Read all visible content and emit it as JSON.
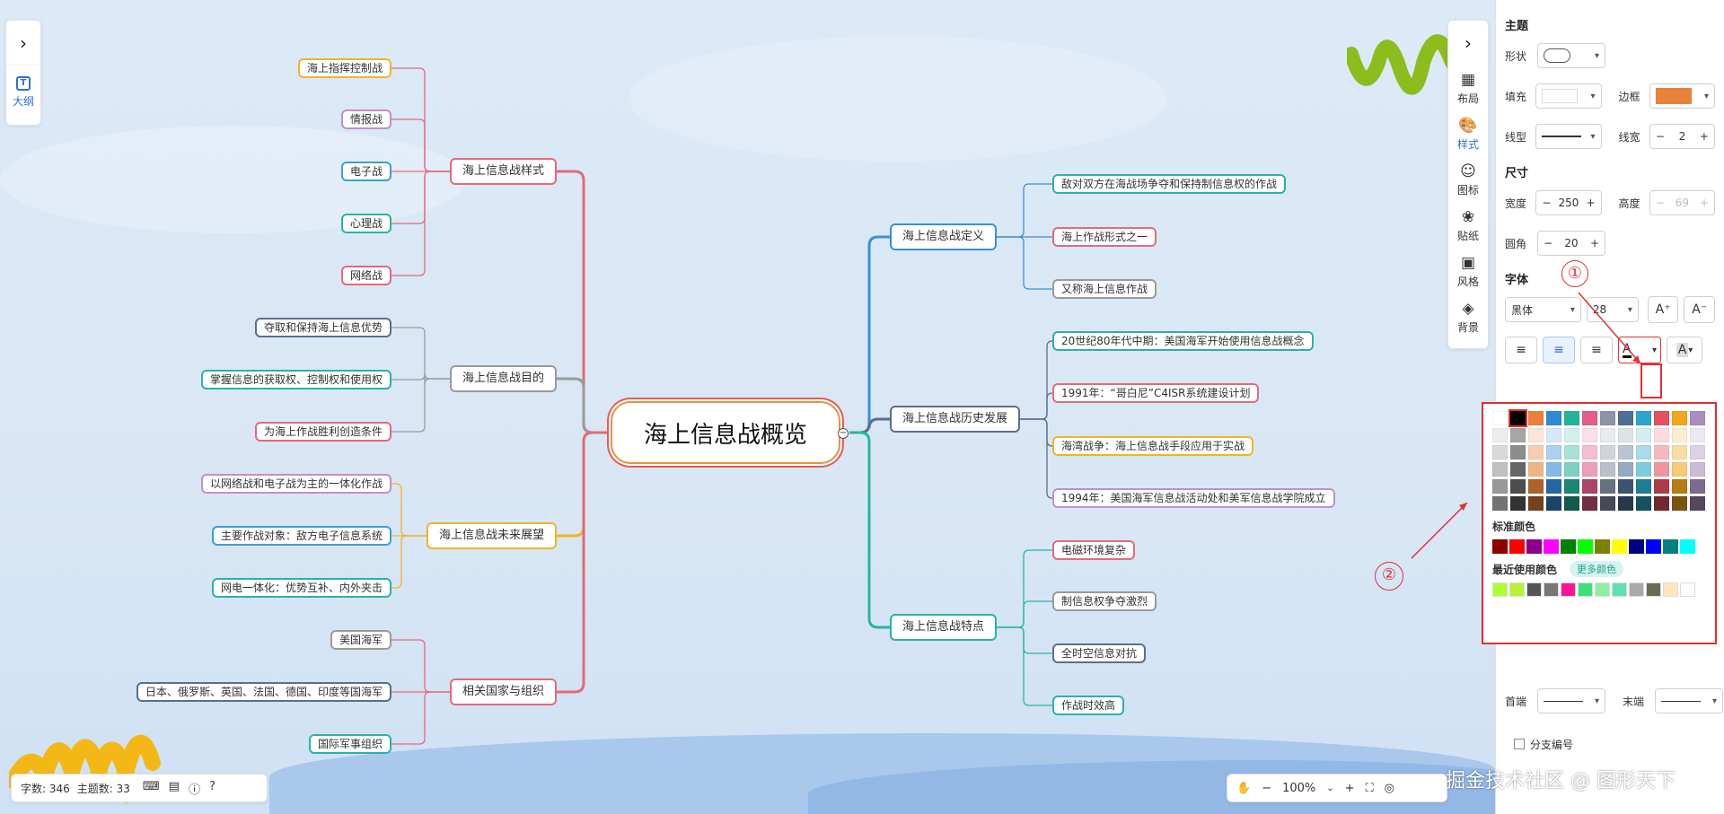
{
  "mindmap": {
    "root": "海上信息战概览",
    "collapse_symbol": "−",
    "left_branches": [
      {
        "label": "海上信息战样式",
        "color": "#e36a7a",
        "children": [
          "海上指挥控制战",
          "情报战",
          "电子战",
          "心理战",
          "网络战"
        ],
        "child_colors": [
          "#f0b429",
          "#c38fc7",
          "#3a9fd6",
          "#2ab3a3",
          "#e36a7a"
        ]
      },
      {
        "label": "海上信息战目的",
        "color": "#9a9a9a",
        "children": [
          "夺取和保持海上信息优势",
          "掌握信息的获取权、控制权和使用权",
          "为海上作战胜利创造条件"
        ],
        "child_colors": [
          "#5b6e8c",
          "#2ab3a3",
          "#e36a7a"
        ]
      },
      {
        "label": "海上信息战未来展望",
        "color": "#f0b429",
        "children": [
          "以网络战和电子战为主的一体化作战",
          "主要作战对象：敌方电子信息系统",
          "网电一体化：优势互补、内外夹击"
        ],
        "child_colors": [
          "#c38fc7",
          "#3a9fd6",
          "#2ab3a3"
        ]
      },
      {
        "label": "相关国家与组织",
        "color": "#e36a7a",
        "children": [
          "美国海军",
          "日本、俄罗斯、英国、法国、德国、印度等国海军",
          "国际军事组织"
        ],
        "child_colors": [
          "#9a9a9a",
          "#5b6e8c",
          "#2ab3a3"
        ]
      }
    ],
    "right_branches": [
      {
        "label": "海上信息战定义",
        "color": "#3a8fd6",
        "children": [
          "敌对双方在海战场争夺和保持制信息权的作战",
          "海上作战形式之一",
          "又称海上信息作战"
        ],
        "child_colors": [
          "#2ab3a3",
          "#e36a7a",
          "#9a9a9a"
        ]
      },
      {
        "label": "海上信息战历史发展",
        "color": "#5b6e8c",
        "children": [
          "20世纪80年代中期：美国海军开始使用信息战概念",
          "1991年：“哥白尼”C4ISR系统建设计划",
          "海湾战争：海上信息战手段应用于实战",
          "1994年：美国海军信息战活动处和美军信息战学院成立"
        ],
        "child_colors": [
          "#2ab3a3",
          "#e36a7a",
          "#f0b429",
          "#c38fc7"
        ]
      },
      {
        "label": "海上信息战特点",
        "color": "#2ab3a3",
        "children": [
          "电磁环境复杂",
          "制信息权争夺激烈",
          "全时空信息对抗",
          "作战时效高"
        ],
        "child_colors": [
          "#e36a7a",
          "#9a9a9a",
          "#5b6e8c",
          "#2ab3a3"
        ]
      }
    ]
  },
  "left_panel": {
    "collapse_icon": "chevron-right-icon",
    "collapse_glyph": "›",
    "outline_icon_glyph": "T",
    "outline_label": "大纲"
  },
  "right_toolbar": {
    "collapse_glyph": "›",
    "items": [
      {
        "label": "布局",
        "glyph": "▦"
      },
      {
        "label": "样式",
        "glyph": "🎨"
      },
      {
        "label": "图标",
        "glyph": "☺"
      },
      {
        "label": "贴纸",
        "glyph": "❀"
      },
      {
        "label": "风格",
        "glyph": "▣"
      },
      {
        "label": "背景",
        "glyph": "◈"
      }
    ]
  },
  "status": {
    "word_count": "字数: 346",
    "topic_count": "主题数: 33"
  },
  "zoom": {
    "value": "100%",
    "minus": "−",
    "plus": "+"
  },
  "watermark": "掘金技术社区 @ 图形天下",
  "style_panel": {
    "theme_title": "主题",
    "shape_label": "形状",
    "fill_label": "填充",
    "border_label": "边框",
    "border_color": "#e8823a",
    "line_type_label": "线型",
    "line_width_label": "线宽",
    "line_width_value": "2",
    "size_title": "尺寸",
    "width_label": "宽度",
    "width_value": "250",
    "height_label": "高度",
    "height_value": "69",
    "radius_label": "圆角",
    "radius_value": "20",
    "font_title": "字体",
    "font_family": "黑体",
    "font_size": "28",
    "font_grow": "A⁺",
    "font_shrink": "A⁻",
    "text_color_glyph": "A",
    "highlight_glyph": "A",
    "start_label": "首端",
    "end_label": "末端",
    "branch_number_label": "分支编号"
  },
  "color_picker": {
    "standard_label": "标准颜色",
    "recent_label": "最近使用颜色",
    "more_label": "更多颜色",
    "base_row": [
      "#ffffff",
      "#000000",
      "#e8823a",
      "#2f8ad6",
      "#25b39a",
      "#e35d86",
      "#8a96a8",
      "#4f6f96",
      "#2aa6c8",
      "#e64f60",
      "#f1a71c",
      "#a98dbd"
    ],
    "standard": [
      "#8b0000",
      "#ff0000",
      "#8b008b",
      "#ff00ff",
      "#008000",
      "#00ff00",
      "#808000",
      "#ffff00",
      "#000080",
      "#0000ff",
      "#008080",
      "#00ffff"
    ],
    "recent": [
      "#adff2f",
      "#b8f03a",
      "#555555",
      "#777777",
      "#ff1493",
      "#3ee07a",
      "#8ef0a0",
      "#5fe0b0",
      "#aaaaaa",
      "#6b6b50",
      "#fde5c0",
      "#ffffff"
    ]
  },
  "annotations": {
    "one": "①",
    "two": "②"
  }
}
